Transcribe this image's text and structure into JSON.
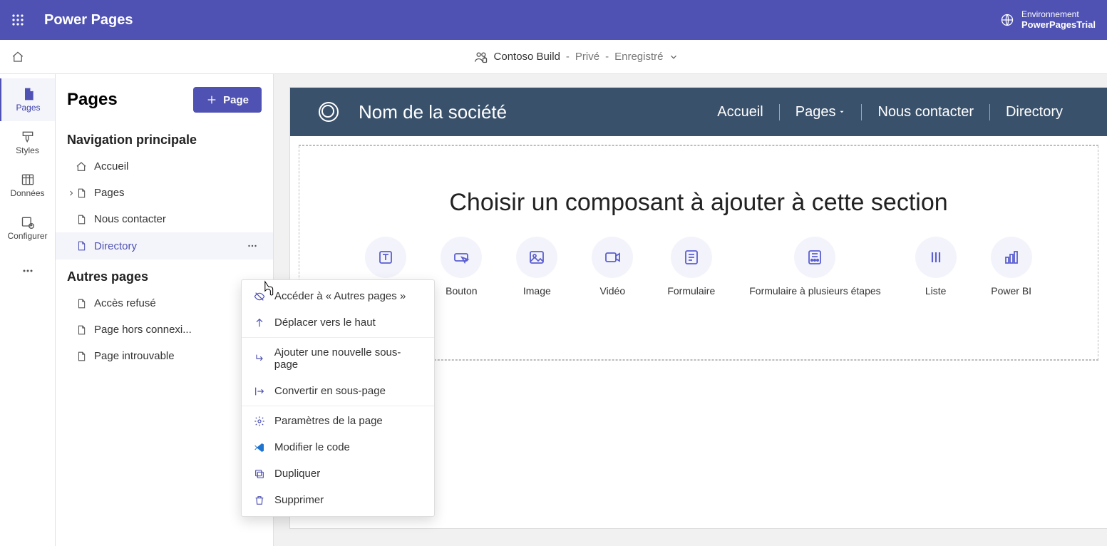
{
  "header": {
    "app_title": "Power Pages",
    "env_label": "Environnement",
    "env_value": "PowerPagesTrial"
  },
  "subheader": {
    "site_name": "Contoso Build",
    "privacy": "Privé",
    "save_status": "Enregistré"
  },
  "nav_rail": {
    "items": [
      {
        "label": "Pages"
      },
      {
        "label": "Styles"
      },
      {
        "label": "Données"
      },
      {
        "label": "Configurer"
      }
    ]
  },
  "pages_panel": {
    "title": "Pages",
    "add_btn": "Page",
    "group_main": "Navigation principale",
    "main_items": [
      {
        "label": "Accueil"
      },
      {
        "label": "Pages"
      },
      {
        "label": "Nous contacter"
      },
      {
        "label": "Directory"
      }
    ],
    "group_other": "Autres pages",
    "other_items": [
      {
        "label": "Accès refusé"
      },
      {
        "label": "Page hors connexi..."
      },
      {
        "label": "Page introuvable"
      }
    ]
  },
  "site": {
    "company": "Nom de la société",
    "nav": [
      {
        "label": "Accueil"
      },
      {
        "label": "Pages"
      },
      {
        "label": "Nous contacter"
      },
      {
        "label": "Directory"
      }
    ],
    "section_title": "Choisir un composant à ajouter à cette section",
    "components": [
      {
        "label": "Texte"
      },
      {
        "label": "Bouton"
      },
      {
        "label": "Image"
      },
      {
        "label": "Vidéo"
      },
      {
        "label": "Formulaire"
      },
      {
        "label": "Formulaire à plusieurs étapes"
      },
      {
        "label": "Liste"
      },
      {
        "label": "Power BI"
      }
    ]
  },
  "context_menu": {
    "items": [
      {
        "label": "Accéder à « Autres pages »"
      },
      {
        "label": "Déplacer vers le haut"
      },
      {
        "label": "Ajouter une nouvelle sous-page"
      },
      {
        "label": "Convertir en sous-page"
      },
      {
        "label": "Paramètres de la page"
      },
      {
        "label": "Modifier le code"
      },
      {
        "label": "Dupliquer"
      },
      {
        "label": "Supprimer"
      }
    ]
  }
}
